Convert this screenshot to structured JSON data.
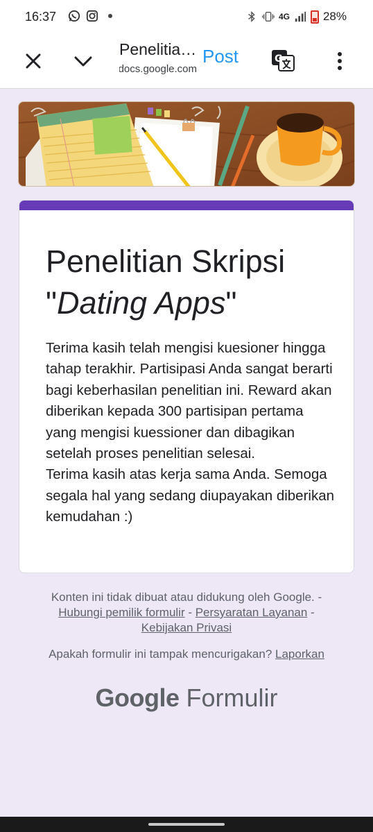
{
  "status_bar": {
    "time": "16:37",
    "left_icons": [
      "whatsapp-icon",
      "instagram-icon",
      "notification-dot-icon"
    ],
    "network": "4G",
    "battery": "28%"
  },
  "browser_bar": {
    "title": "Penelitian Skripsi",
    "url": "docs.google.com",
    "post_label": "Post",
    "accent_color": "#2196f3"
  },
  "form": {
    "accent_color": "#673ab7",
    "title_prefix": "Penelitian Skripsi \"",
    "title_italic": "Dating Apps",
    "title_suffix": "\"",
    "description": "Terima kasih telah mengisi kuesioner hingga tahap terakhir. Partisipasi Anda sangat berarti bagi keberhasilan penelitian ini. Reward akan diberikan kepada 300 partisipan pertama yang mengisi kuessioner dan dibagikan setelah proses penelitian selesai.\nTerima kasih atas kerja sama Anda. Semoga segala hal yang sedang diupayakan diberikan kemudahan :)"
  },
  "footer": {
    "disclaimer": "Konten ini tidak dibuat atau didukung oleh Google. -",
    "link_contact": "Hubungi pemilik formulir",
    "sep1": " - ",
    "link_terms": "Persyaratan Layanan",
    "sep2": " -",
    "link_privacy": "Kebijakan Privasi",
    "suspicious_text": "Apakah formulir ini tampak mencurigakan? ",
    "link_report": "Laporkan",
    "brand_google": "Google",
    "brand_product": "Formulir"
  }
}
